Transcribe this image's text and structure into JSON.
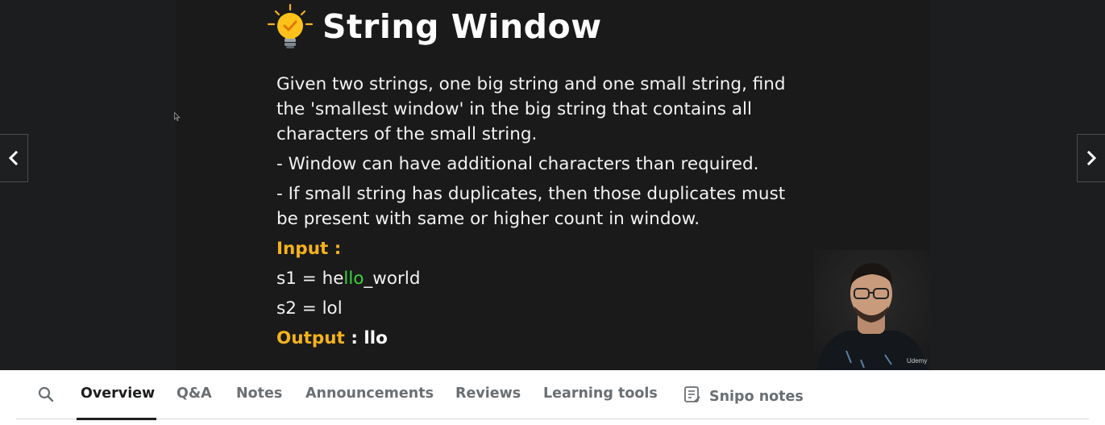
{
  "slide": {
    "title": "String Window",
    "description_lines": [
      "Given two strings, one big string and one small string, find",
      "the 'smallest window' in the big string that contains all",
      "characters of the small string."
    ],
    "rule1": "- Window can have additional characters than required.",
    "rule2_lines": [
      "- If small string has duplicates, then those duplicates must",
      "be present  with same or higher count in window."
    ],
    "input_label": "Input :",
    "s1_prefix": "s1 = he",
    "s1_highlight": "llo",
    "s1_suffix": "_world",
    "s2": "s2 = lol",
    "output_label": "Output",
    "output_value": " : llo"
  },
  "webcam": {
    "watermark": "Udemy"
  },
  "tabs": {
    "items": [
      {
        "label": "Overview",
        "active": true
      },
      {
        "label": "Q&A",
        "active": false
      },
      {
        "label": "Notes",
        "active": false
      },
      {
        "label": "Announcements",
        "active": false
      },
      {
        "label": "Reviews",
        "active": false
      },
      {
        "label": "Learning tools",
        "active": false
      },
      {
        "label": "Snipo notes",
        "active": false
      }
    ]
  },
  "icons": {
    "search": "search-icon",
    "prev": "chevron-left-icon",
    "next": "chevron-right-icon",
    "bulb": "lightbulb-icon",
    "snipo": "notes-icon"
  },
  "colors": {
    "accent_yellow": "#f5b21b",
    "highlight_green": "#3bd33b",
    "slide_bg": "#1a1a1a",
    "tab_active": "#1c1d1f",
    "tab_inactive": "#6a6f73"
  }
}
